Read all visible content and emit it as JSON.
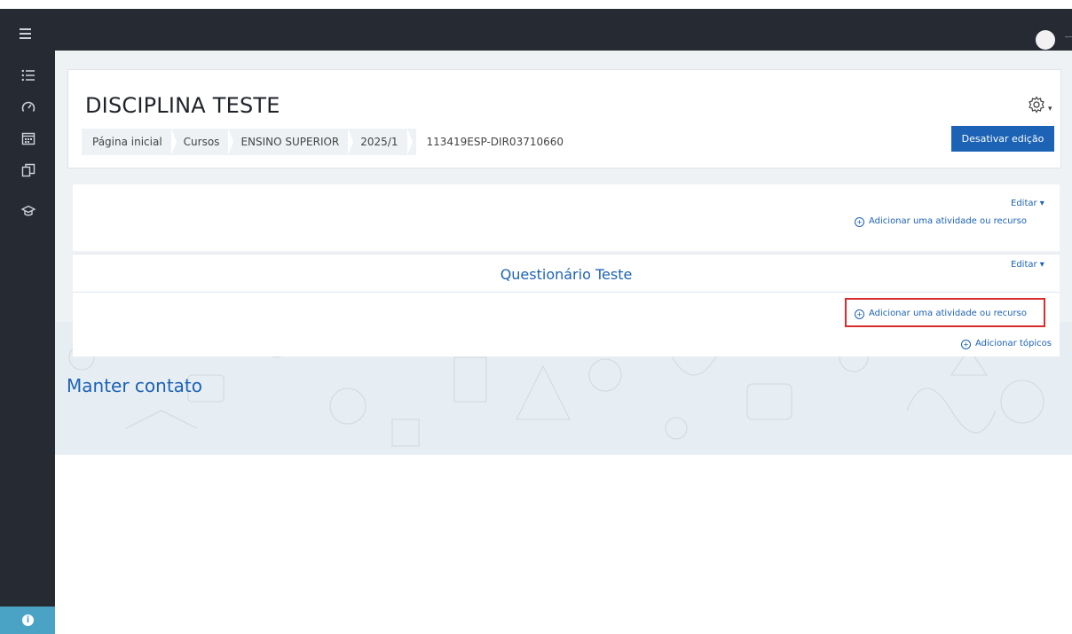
{
  "course": {
    "title": "DISCIPLINA TESTE"
  },
  "breadcrumb": [
    "Página inicial",
    "Cursos",
    "ENSINO SUPERIOR",
    "2025/1",
    "113419ESP-DIR03710660"
  ],
  "header": {
    "edit_button": "Desativar edição",
    "gear_caret": "▾"
  },
  "sections": {
    "section0": {
      "edit_label": "Editar ▾",
      "add_label": "Adicionar uma atividade ou recurso"
    },
    "section1": {
      "title": "Questionário Teste",
      "edit_label": "Editar ▾",
      "add_label": "Adicionar uma atividade ou recurso"
    },
    "add_topics": "Adicionar tópicos"
  },
  "footer": {
    "contact_title": "Manter contato"
  },
  "icons": {
    "menu": "hamburger-icon",
    "nav": [
      "list-icon",
      "dashboard-icon",
      "calendar-icon",
      "files-icon",
      "graduation-cap-icon"
    ],
    "info": "info-icon",
    "settings": "gear-icon",
    "user": "avatar-icon"
  },
  "colors": {
    "navbar": "#262a33",
    "primary": "#1c62b5",
    "highlight": "#d92c2c",
    "info": "#4aa3c5"
  },
  "info_glyph": "i",
  "plus_glyph": "+"
}
